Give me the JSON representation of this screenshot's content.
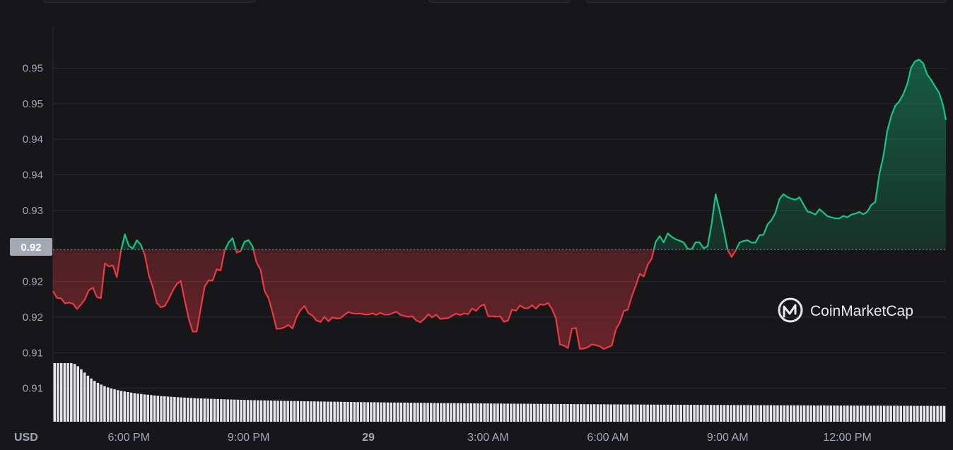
{
  "chart_data": {
    "type": "area",
    "currency_label": "USD",
    "y_tick_labels": [
      "0.95",
      "0.95",
      "0.94",
      "0.94",
      "0.93",
      "0.92",
      "0.92",
      "0.91",
      "0.91"
    ],
    "y_tick_values": [
      0.9537,
      0.9487,
      0.9437,
      0.9387,
      0.9337,
      0.9237,
      0.9187,
      0.9137,
      0.9087
    ],
    "ylim": [
      0.904,
      0.9595
    ],
    "x_tick_labels": [
      "6:00 PM",
      "9:00 PM",
      "29",
      "3:00 AM",
      "6:00 AM",
      "9:00 AM",
      "12:00 PM"
    ],
    "x_tick_hours": [
      18,
      21,
      24,
      27,
      30,
      33,
      36
    ],
    "x_tick_bold": [
      false,
      false,
      true,
      false,
      false,
      false,
      false
    ],
    "xlim_hours": [
      16.1,
      38.47
    ],
    "reference_price": {
      "label": "0.92",
      "value": 0.9282
    },
    "grid": true,
    "colors": {
      "up": "#16c784",
      "down": "#ea3943",
      "volume": "#f0f1f4",
      "grid": "#2a2c33",
      "ref_line": "#8a8d96"
    },
    "watermark": "CoinMarketCap",
    "price_points": [
      [
        16.1,
        0.92237
      ],
      [
        16.2,
        0.92139
      ],
      [
        16.3,
        0.92135
      ],
      [
        16.4,
        0.92064
      ],
      [
        16.5,
        0.92074
      ],
      [
        16.6,
        0.92059
      ],
      [
        16.7,
        0.91985
      ],
      [
        16.8,
        0.92045
      ],
      [
        16.9,
        0.92123
      ],
      [
        17.0,
        0.92252
      ],
      [
        17.1,
        0.92282
      ],
      [
        17.2,
        0.92153
      ],
      [
        17.3,
        0.92137
      ],
      [
        17.4,
        0.92626
      ],
      [
        17.5,
        0.92583
      ],
      [
        17.6,
        0.92596
      ],
      [
        17.7,
        0.92433
      ],
      [
        17.8,
        0.92797
      ],
      [
        17.9,
        0.93034
      ],
      [
        18.0,
        0.92873
      ],
      [
        18.1,
        0.92835
      ],
      [
        18.2,
        0.9295
      ],
      [
        18.3,
        0.92887
      ],
      [
        18.4,
        0.92743
      ],
      [
        18.5,
        0.92461
      ],
      [
        18.6,
        0.92289
      ],
      [
        18.7,
        0.92072
      ],
      [
        18.8,
        0.92009
      ],
      [
        18.9,
        0.92026
      ],
      [
        19.0,
        0.92126
      ],
      [
        19.1,
        0.92243
      ],
      [
        19.2,
        0.92336
      ],
      [
        19.3,
        0.9238
      ],
      [
        19.4,
        0.92104
      ],
      [
        19.5,
        0.91848
      ],
      [
        19.6,
        0.91667
      ],
      [
        19.7,
        0.91667
      ],
      [
        19.8,
        0.91993
      ],
      [
        19.9,
        0.92302
      ],
      [
        20.0,
        0.92387
      ],
      [
        20.1,
        0.92386
      ],
      [
        20.2,
        0.92544
      ],
      [
        20.3,
        0.92526
      ],
      [
        20.4,
        0.92807
      ],
      [
        20.5,
        0.9292
      ],
      [
        20.6,
        0.9298
      ],
      [
        20.7,
        0.92778
      ],
      [
        20.8,
        0.92798
      ],
      [
        20.9,
        0.92931
      ],
      [
        21.0,
        0.92952
      ],
      [
        21.1,
        0.92862
      ],
      [
        21.2,
        0.92637
      ],
      [
        21.3,
        0.92536
      ],
      [
        21.4,
        0.92239
      ],
      [
        21.5,
        0.92136
      ],
      [
        21.6,
        0.91936
      ],
      [
        21.7,
        0.91706
      ],
      [
        21.8,
        0.91709
      ],
      [
        21.9,
        0.91728
      ],
      [
        22.0,
        0.91762
      ],
      [
        22.1,
        0.91711
      ],
      [
        22.2,
        0.91869
      ],
      [
        22.3,
        0.91969
      ],
      [
        22.4,
        0.92028
      ],
      [
        22.5,
        0.91925
      ],
      [
        22.6,
        0.91891
      ],
      [
        22.7,
        0.91823
      ],
      [
        22.8,
        0.91802
      ],
      [
        22.9,
        0.91874
      ],
      [
        23.0,
        0.91812
      ],
      [
        23.1,
        0.91866
      ],
      [
        23.2,
        0.91852
      ],
      [
        23.3,
        0.91855
      ],
      [
        23.4,
        0.91902
      ],
      [
        23.5,
        0.91943
      ],
      [
        23.6,
        0.91924
      ],
      [
        23.7,
        0.91919
      ],
      [
        23.8,
        0.91921
      ],
      [
        23.9,
        0.91909
      ],
      [
        24.0,
        0.91906
      ],
      [
        24.1,
        0.91925
      ],
      [
        24.2,
        0.91901
      ],
      [
        24.3,
        0.91932
      ],
      [
        24.4,
        0.91906
      ],
      [
        24.5,
        0.91905
      ],
      [
        24.6,
        0.91924
      ],
      [
        24.7,
        0.91947
      ],
      [
        24.8,
        0.91902
      ],
      [
        24.9,
        0.91889
      ],
      [
        25.0,
        0.91874
      ],
      [
        25.1,
        0.91883
      ],
      [
        25.2,
        0.91825
      ],
      [
        25.3,
        0.91798
      ],
      [
        25.4,
        0.91843
      ],
      [
        25.5,
        0.9191
      ],
      [
        25.6,
        0.91866
      ],
      [
        25.7,
        0.91907
      ],
      [
        25.8,
        0.91844
      ],
      [
        25.9,
        0.91852
      ],
      [
        26.0,
        0.91856
      ],
      [
        26.1,
        0.91892
      ],
      [
        26.2,
        0.9192
      ],
      [
        26.3,
        0.919
      ],
      [
        26.4,
        0.91922
      ],
      [
        26.5,
        0.91912
      ],
      [
        26.6,
        0.91993
      ],
      [
        26.7,
        0.91958
      ],
      [
        26.8,
        0.92021
      ],
      [
        26.9,
        0.92049
      ],
      [
        27.0,
        0.91885
      ],
      [
        27.1,
        0.91885
      ],
      [
        27.2,
        0.91876
      ],
      [
        27.3,
        0.91881
      ],
      [
        27.4,
        0.91804
      ],
      [
        27.5,
        0.91823
      ],
      [
        27.6,
        0.91977
      ],
      [
        27.7,
        0.9196
      ],
      [
        27.8,
        0.92035
      ],
      [
        27.9,
        0.91998
      ],
      [
        28.0,
        0.91994
      ],
      [
        28.1,
        0.92037
      ],
      [
        28.2,
        0.91989
      ],
      [
        28.3,
        0.9205
      ],
      [
        28.4,
        0.92042
      ],
      [
        28.5,
        0.92069
      ],
      [
        28.6,
        0.91986
      ],
      [
        28.7,
        0.91853
      ],
      [
        28.8,
        0.91488
      ],
      [
        28.9,
        0.91471
      ],
      [
        29.0,
        0.91436
      ],
      [
        29.1,
        0.91709
      ],
      [
        29.2,
        0.91718
      ],
      [
        29.3,
        0.91425
      ],
      [
        29.4,
        0.91428
      ],
      [
        29.5,
        0.91448
      ],
      [
        29.6,
        0.91488
      ],
      [
        29.7,
        0.91477
      ],
      [
        29.8,
        0.91459
      ],
      [
        29.9,
        0.91423
      ],
      [
        30.0,
        0.91447
      ],
      [
        30.1,
        0.91471
      ],
      [
        30.2,
        0.91698
      ],
      [
        30.3,
        0.91794
      ],
      [
        30.4,
        0.91955
      ],
      [
        30.5,
        0.91977
      ],
      [
        30.6,
        0.92163
      ],
      [
        30.7,
        0.92311
      ],
      [
        30.8,
        0.9248
      ],
      [
        30.9,
        0.92441
      ],
      [
        31.0,
        0.92609
      ],
      [
        31.1,
        0.92693
      ],
      [
        31.2,
        0.92929
      ],
      [
        31.3,
        0.93008
      ],
      [
        31.4,
        0.9292
      ],
      [
        31.5,
        0.93048
      ],
      [
        31.6,
        0.92998
      ],
      [
        31.7,
        0.92964
      ],
      [
        31.8,
        0.92944
      ],
      [
        31.9,
        0.92919
      ],
      [
        32.0,
        0.92831
      ],
      [
        32.1,
        0.92822
      ],
      [
        32.2,
        0.92923
      ],
      [
        32.3,
        0.92919
      ],
      [
        32.4,
        0.92837
      ],
      [
        32.5,
        0.92868
      ],
      [
        32.6,
        0.93179
      ],
      [
        32.7,
        0.93596
      ],
      [
        32.8,
        0.93365
      ],
      [
        32.9,
        0.93102
      ],
      [
        33.0,
        0.92815
      ],
      [
        33.1,
        0.92715
      ],
      [
        33.2,
        0.92804
      ],
      [
        33.3,
        0.92918
      ],
      [
        33.4,
        0.9294
      ],
      [
        33.5,
        0.92951
      ],
      [
        33.6,
        0.92918
      ],
      [
        33.7,
        0.92917
      ],
      [
        33.8,
        0.93023
      ],
      [
        33.9,
        0.93028
      ],
      [
        34.0,
        0.93172
      ],
      [
        34.1,
        0.93233
      ],
      [
        34.2,
        0.93339
      ],
      [
        34.3,
        0.9353
      ],
      [
        34.4,
        0.93598
      ],
      [
        34.5,
        0.93558
      ],
      [
        34.6,
        0.93534
      ],
      [
        34.7,
        0.93521
      ],
      [
        34.8,
        0.93554
      ],
      [
        34.9,
        0.93457
      ],
      [
        35.0,
        0.93356
      ],
      [
        35.1,
        0.93339
      ],
      [
        35.2,
        0.93311
      ],
      [
        35.3,
        0.93387
      ],
      [
        35.4,
        0.9334
      ],
      [
        35.5,
        0.9329
      ],
      [
        35.6,
        0.93274
      ],
      [
        35.7,
        0.93258
      ],
      [
        35.8,
        0.93257
      ],
      [
        35.9,
        0.93294
      ],
      [
        36.0,
        0.93273
      ],
      [
        36.1,
        0.93311
      ],
      [
        36.2,
        0.93325
      ],
      [
        36.3,
        0.93348
      ],
      [
        36.4,
        0.93316
      ],
      [
        36.5,
        0.9335
      ],
      [
        36.6,
        0.93447
      ],
      [
        36.7,
        0.93488
      ],
      [
        36.8,
        0.93874
      ],
      [
        36.9,
        0.94123
      ],
      [
        37.0,
        0.94486
      ],
      [
        37.1,
        0.94695
      ],
      [
        37.2,
        0.94842
      ],
      [
        37.3,
        0.94902
      ],
      [
        37.4,
        0.95001
      ],
      [
        37.5,
        0.95143
      ],
      [
        37.6,
        0.95379
      ],
      [
        37.7,
        0.95467
      ],
      [
        37.8,
        0.95489
      ],
      [
        37.9,
        0.95437
      ],
      [
        38.0,
        0.95281
      ],
      [
        38.1,
        0.95204
      ],
      [
        38.2,
        0.95111
      ],
      [
        38.3,
        0.95022
      ],
      [
        38.4,
        0.94842
      ],
      [
        38.47,
        0.9464
      ]
    ],
    "volume": [
      1.0,
      1.0,
      1.0,
      1.0,
      1.0,
      1.0,
      0.986,
      0.947,
      0.895,
      0.839,
      0.786,
      0.738,
      0.697,
      0.663,
      0.633,
      0.608,
      0.587,
      0.569,
      0.553,
      0.539,
      0.527,
      0.516,
      0.506,
      0.497,
      0.488,
      0.48,
      0.473,
      0.466,
      0.46,
      0.454,
      0.448,
      0.443,
      0.438,
      0.434,
      0.43,
      0.426,
      0.422,
      0.418,
      0.415,
      0.412,
      0.409,
      0.406,
      0.403,
      0.4,
      0.398,
      0.395,
      0.393,
      0.391,
      0.389,
      0.387,
      0.385,
      0.383,
      0.381,
      0.379,
      0.377,
      0.376,
      0.374,
      0.372,
      0.371,
      0.369,
      0.368,
      0.367,
      0.365,
      0.364,
      0.363,
      0.361,
      0.36,
      0.359,
      0.358,
      0.356,
      0.355,
      0.354,
      0.353,
      0.352,
      0.351,
      0.35,
      0.349,
      0.348,
      0.347,
      0.346,
      0.345,
      0.344,
      0.343,
      0.342,
      0.341,
      0.341,
      0.34,
      0.339,
      0.338,
      0.337,
      0.336,
      0.336,
      0.335,
      0.334,
      0.333,
      0.333,
      0.332,
      0.331,
      0.33,
      0.33,
      0.329,
      0.328,
      0.328,
      0.327,
      0.326,
      0.326,
      0.325,
      0.324,
      0.324,
      0.323,
      0.322,
      0.322,
      0.321,
      0.321,
      0.32,
      0.319,
      0.319,
      0.318,
      0.318,
      0.317,
      0.317,
      0.316,
      0.316,
      0.315,
      0.315,
      0.314,
      0.314,
      0.313,
      0.313,
      0.312,
      0.312,
      0.311,
      0.311,
      0.31,
      0.31,
      0.309,
      0.309,
      0.308,
      0.308,
      0.307,
      0.307,
      0.307,
      0.306,
      0.306,
      0.305,
      0.305,
      0.304,
      0.304,
      0.304,
      0.303,
      0.303,
      0.302,
      0.302,
      0.302,
      0.301,
      0.301,
      0.3,
      0.3,
      0.3,
      0.299,
      0.299,
      0.298,
      0.298,
      0.298,
      0.297,
      0.297,
      0.297,
      0.296,
      0.296,
      0.296,
      0.295,
      0.295,
      0.295,
      0.294,
      0.294,
      0.294,
      0.293,
      0.293,
      0.293,
      0.292,
      0.292,
      0.292,
      0.291,
      0.291,
      0.291,
      0.29,
      0.29,
      0.29,
      0.289,
      0.289,
      0.289,
      0.288,
      0.288,
      0.288,
      0.288,
      0.287,
      0.287,
      0.287,
      0.286,
      0.286,
      0.286,
      0.286,
      0.285,
      0.285,
      0.285,
      0.284,
      0.284,
      0.284,
      0.284,
      0.283,
      0.283,
      0.283,
      0.282,
      0.282,
      0.282,
      0.282,
      0.281,
      0.281,
      0.281,
      0.281,
      0.28,
      0.28,
      0.28,
      0.28,
      0.279,
      0.279,
      0.279,
      0.279,
      0.278,
      0.278,
      0.278,
      0.278,
      0.277,
      0.277,
      0.277,
      0.277,
      0.276,
      0.276,
      0.276,
      0.276,
      0.275,
      0.275,
      0.275,
      0.275,
      0.275,
      0.274,
      0.274,
      0.274,
      0.274,
      0.273,
      0.273,
      0.273,
      0.273,
      0.273,
      0.272,
      0.272,
      0.272,
      0.272,
      0.271,
      0.271,
      0.271,
      0.271,
      0.271,
      0.27,
      0.27,
      0.27,
      0.27,
      0.27
    ]
  }
}
